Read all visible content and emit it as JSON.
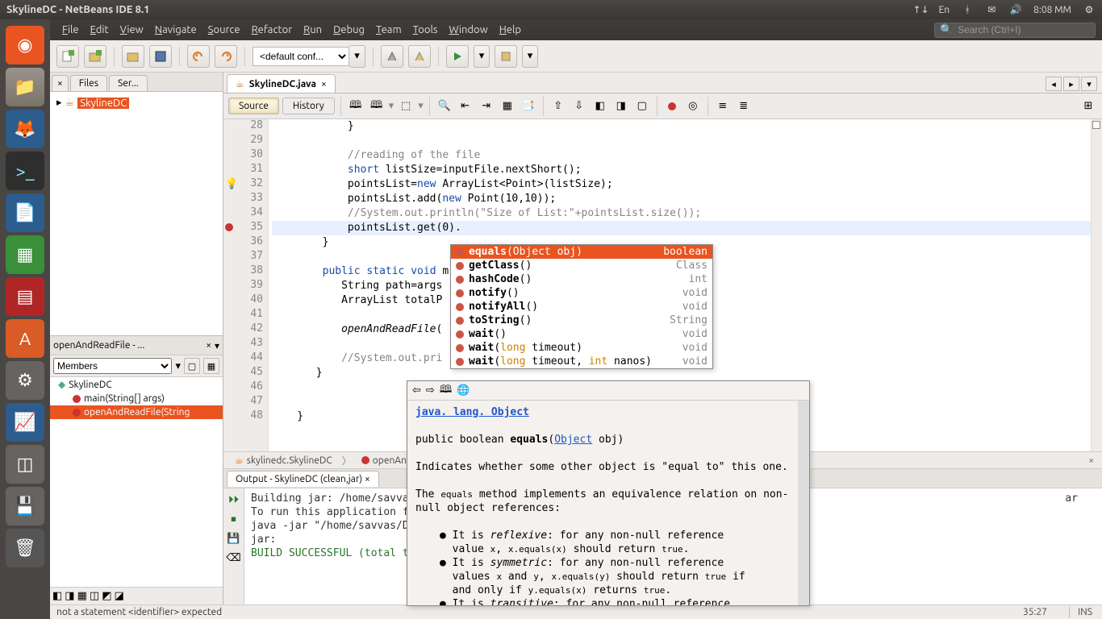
{
  "topbar": {
    "app_title": "SkylineDC - NetBeans IDE 8.1",
    "lang": "En",
    "clock": "8:08 MM"
  },
  "menu": {
    "items": [
      "File",
      "Edit",
      "View",
      "Navigate",
      "Source",
      "Refactor",
      "Run",
      "Debug",
      "Team",
      "Tools",
      "Window",
      "Help"
    ],
    "search_placeholder": "Search (Ctrl+I)"
  },
  "toolbar": {
    "config": "<default conf..."
  },
  "sidebar_tabs": {
    "files": "Files",
    "services": "Ser...",
    "project_root": "SkylineDC",
    "close_icon": "×"
  },
  "navigator": {
    "panel_title": "openAndReadFile - ...",
    "dropdown": "Members",
    "nodes": [
      {
        "label": "SkylineDC",
        "kind": "class"
      },
      {
        "label": "main(String[] args)",
        "kind": "method"
      },
      {
        "label": "openAndReadFile(String",
        "kind": "method",
        "sel": true
      }
    ]
  },
  "editor": {
    "tab_title": "SkylineDC.java",
    "view_source": "Source",
    "view_history": "History",
    "gutter_start": 28,
    "lines": [
      "            }",
      "",
      "            //reading of the file",
      "            short listSize=inputFile.nextShort();",
      "            pointsList=new ArrayList<Point>(listSize);",
      "            pointsList.add(new Point(10,10));",
      "            //System.out.println(\"Size of List:\"+pointsList.size());",
      "            pointsList.get(0).",
      "        }",
      "",
      "        public static void m",
      "           String path=args",
      "           ArrayList totalP",
      "",
      "           openAndReadFile(",
      "",
      "           //System.out.pri",
      "       }",
      "",
      "",
      "    }"
    ],
    "hl_index": 7,
    "err_index": 7,
    "bulb_indices": [
      4
    ]
  },
  "completion": {
    "items": [
      {
        "name": "equals",
        "params": "(Object obj)",
        "ret": "boolean",
        "sel": true
      },
      {
        "name": "getClass",
        "params": "()",
        "ret": "Class<?>"
      },
      {
        "name": "hashCode",
        "params": "()",
        "ret": "int"
      },
      {
        "name": "notify",
        "params": "()",
        "ret": "void"
      },
      {
        "name": "notifyAll",
        "params": "()",
        "ret": "void"
      },
      {
        "name": "toString",
        "params": "()",
        "ret": "String"
      },
      {
        "name": "wait",
        "params": "()",
        "ret": "void"
      },
      {
        "name": "wait",
        "params": "(long timeout)",
        "ret": "void"
      },
      {
        "name": "wait",
        "params": "(long timeout, int nanos)",
        "ret": "void"
      }
    ]
  },
  "javadoc": {
    "heading": "java. lang. Object",
    "sig_pre": "public boolean ",
    "sig_name": "equals",
    "sig_mid": "(",
    "sig_type": "Object",
    "sig_post": " obj)",
    "desc1": "Indicates whether some other object is \"equal to\" this one.",
    "desc2": "The equals method implements an equivalence relation on non-null object references:",
    "b1": "It is reflexive: for any non-null reference value x, x.equals(x) should return true.",
    "b2": "It is symmetric: for any non-null reference values x and y, x.equals(y) should return true if and only if y.equals(x) returns true.",
    "b3": "It is transitive: for any non-null reference"
  },
  "breadcrumb": {
    "s1": "skylinedc.SkylineDC",
    "s2": "openAnd"
  },
  "output": {
    "tab": "Output - SkylineDC (clean,jar)",
    "lines": [
      "Building jar: /home/savva",
      "To run this application f",
      "java -jar \"/home/savvas/D",
      "jar:"
    ],
    "build": "BUILD SUCCESSFUL (total t",
    "side_text": "ar"
  },
  "status": {
    "err": "not a statement  <identifier> expected",
    "pos": "35:27",
    "ins": "INS"
  }
}
